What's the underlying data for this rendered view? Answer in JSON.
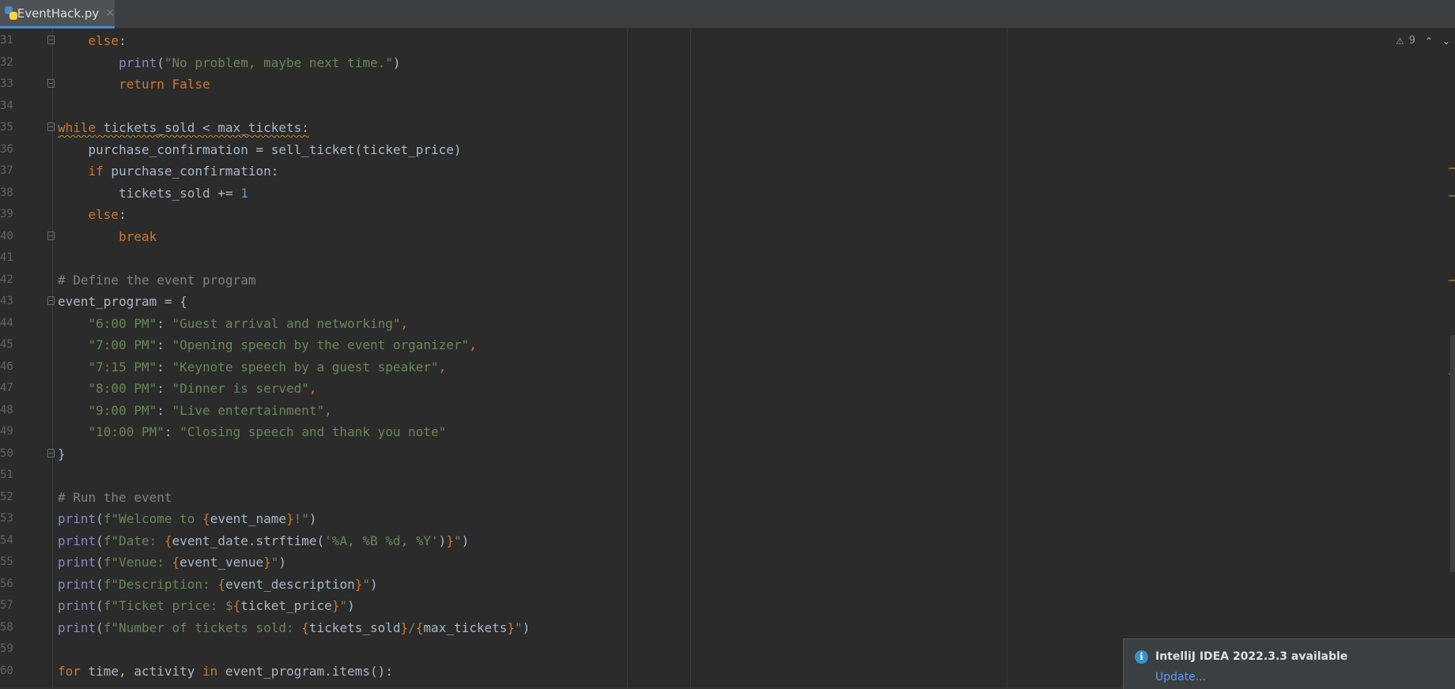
{
  "tab": {
    "filename": "EventHack.py",
    "close": "✕",
    "icon": "python-file-icon"
  },
  "inspection": {
    "warning_count": "9",
    "warning_icon": "⚠",
    "up": "⌃",
    "down": "⌄"
  },
  "notification": {
    "title": "IntelliJ IDEA 2022.3.3 available",
    "link": "Update...",
    "icon": "i"
  },
  "colors": {
    "keyword": "#cc7832",
    "string": "#6a8759",
    "number": "#6897bb",
    "comment": "#808080",
    "builtin": "#8888c6",
    "text": "#a9b7c6",
    "accent": "#4a88c7"
  },
  "code_lines": [
    {
      "n": "31",
      "tokens": [
        [
          "",
          "    "
        ],
        [
          "kw",
          "else"
        ],
        [
          "",
          ":"
        ]
      ]
    },
    {
      "n": "32",
      "tokens": [
        [
          "",
          "        "
        ],
        [
          "fn",
          "print"
        ],
        [
          "",
          "("
        ],
        [
          "str",
          "\"No problem, maybe next time.\""
        ],
        [
          "",
          ")"
        ]
      ]
    },
    {
      "n": "33",
      "tokens": [
        [
          "",
          "        "
        ],
        [
          "kw",
          "return False"
        ]
      ]
    },
    {
      "n": "34",
      "tokens": []
    },
    {
      "n": "35",
      "tokens": [
        [
          "kwu",
          "while"
        ],
        [
          "u",
          " tickets_sold < max_tickets:"
        ]
      ]
    },
    {
      "n": "36",
      "tokens": [
        [
          "",
          "    purchase_confirmation = sell_ticket(ticket_price)"
        ]
      ]
    },
    {
      "n": "37",
      "tokens": [
        [
          "",
          "    "
        ],
        [
          "kw",
          "if"
        ],
        [
          "",
          " purchase_confirmation:"
        ]
      ]
    },
    {
      "n": "38",
      "tokens": [
        [
          "",
          "        tickets_sold += "
        ],
        [
          "num",
          "1"
        ]
      ]
    },
    {
      "n": "39",
      "tokens": [
        [
          "",
          "    "
        ],
        [
          "kw",
          "else"
        ],
        [
          "",
          ":"
        ]
      ]
    },
    {
      "n": "40",
      "tokens": [
        [
          "",
          "        "
        ],
        [
          "kw",
          "break"
        ]
      ]
    },
    {
      "n": "41",
      "tokens": []
    },
    {
      "n": "42",
      "tokens": [
        [
          "cm",
          "# Define the event program"
        ]
      ]
    },
    {
      "n": "43",
      "tokens": [
        [
          "",
          "event_program = {"
        ]
      ]
    },
    {
      "n": "44",
      "tokens": [
        [
          "",
          "    "
        ],
        [
          "str",
          "\"6:00 PM\""
        ],
        [
          "",
          ": "
        ],
        [
          "str",
          "\"Guest arrival and networking\""
        ],
        [
          "kw",
          ","
        ]
      ]
    },
    {
      "n": "45",
      "tokens": [
        [
          "",
          "    "
        ],
        [
          "str",
          "\"7:00 PM\""
        ],
        [
          "",
          ": "
        ],
        [
          "str",
          "\"Opening speech by the event organizer\""
        ],
        [
          "kw",
          ","
        ]
      ]
    },
    {
      "n": "46",
      "tokens": [
        [
          "",
          "    "
        ],
        [
          "str",
          "\"7:15 PM\""
        ],
        [
          "",
          ": "
        ],
        [
          "str",
          "\"Keynote speech by a guest speaker\""
        ],
        [
          "kw",
          ","
        ]
      ]
    },
    {
      "n": "47",
      "tokens": [
        [
          "",
          "    "
        ],
        [
          "str",
          "\"8:00 PM\""
        ],
        [
          "",
          ": "
        ],
        [
          "str",
          "\"Dinner is served\""
        ],
        [
          "kw",
          ","
        ]
      ]
    },
    {
      "n": "48",
      "tokens": [
        [
          "",
          "    "
        ],
        [
          "str",
          "\"9:00 PM\""
        ],
        [
          "",
          ": "
        ],
        [
          "str",
          "\"Live entertainment\""
        ],
        [
          "kw",
          ","
        ]
      ]
    },
    {
      "n": "49",
      "tokens": [
        [
          "",
          "    "
        ],
        [
          "str",
          "\"10:00 PM\""
        ],
        [
          "",
          ": "
        ],
        [
          "str",
          "\"Closing speech and thank you note\""
        ]
      ]
    },
    {
      "n": "50",
      "tokens": [
        [
          "",
          "}"
        ]
      ]
    },
    {
      "n": "51",
      "tokens": []
    },
    {
      "n": "52",
      "tokens": [
        [
          "cm",
          "# Run the event"
        ]
      ]
    },
    {
      "n": "53",
      "tokens": [
        [
          "fn",
          "print"
        ],
        [
          "",
          "("
        ],
        [
          "str",
          "f\"Welcome to "
        ],
        [
          "kw",
          "{"
        ],
        [
          "",
          "event_name"
        ],
        [
          "kw",
          "}"
        ],
        [
          "str",
          "!\""
        ],
        [
          "",
          ")"
        ]
      ]
    },
    {
      "n": "54",
      "tokens": [
        [
          "fn",
          "print"
        ],
        [
          "",
          "("
        ],
        [
          "str",
          "f\"Date: "
        ],
        [
          "kw",
          "{"
        ],
        [
          "",
          "event_date.strftime("
        ],
        [
          "str",
          "'%A, %B %d, %Y'"
        ],
        [
          "",
          ")"
        ],
        [
          "kw",
          "}"
        ],
        [
          "str",
          "\""
        ],
        [
          "",
          ")"
        ]
      ]
    },
    {
      "n": "55",
      "tokens": [
        [
          "fn",
          "print"
        ],
        [
          "",
          "("
        ],
        [
          "str",
          "f\"Venue: "
        ],
        [
          "kw",
          "{"
        ],
        [
          "",
          "event_venue"
        ],
        [
          "kw",
          "}"
        ],
        [
          "str",
          "\""
        ],
        [
          "",
          ")"
        ]
      ]
    },
    {
      "n": "56",
      "tokens": [
        [
          "fn",
          "print"
        ],
        [
          "",
          "("
        ],
        [
          "str",
          "f\"Description: "
        ],
        [
          "kw",
          "{"
        ],
        [
          "",
          "event_description"
        ],
        [
          "kw",
          "}"
        ],
        [
          "str",
          "\""
        ],
        [
          "",
          ")"
        ]
      ]
    },
    {
      "n": "57",
      "tokens": [
        [
          "fn",
          "print"
        ],
        [
          "",
          "("
        ],
        [
          "str",
          "f\"Ticket price: $"
        ],
        [
          "kw",
          "{"
        ],
        [
          "",
          "ticket_price"
        ],
        [
          "kw",
          "}"
        ],
        [
          "str",
          "\""
        ],
        [
          "",
          ")"
        ]
      ]
    },
    {
      "n": "58",
      "tokens": [
        [
          "fn",
          "print"
        ],
        [
          "",
          "("
        ],
        [
          "str",
          "f\"Number of tickets sold: "
        ],
        [
          "kw",
          "{"
        ],
        [
          "",
          "tickets_sold"
        ],
        [
          "kw",
          "}"
        ],
        [
          "str",
          "/"
        ],
        [
          "kw",
          "{"
        ],
        [
          "",
          "max_tickets"
        ],
        [
          "kw",
          "}"
        ],
        [
          "str",
          "\""
        ],
        [
          "",
          ")"
        ]
      ]
    },
    {
      "n": "59",
      "tokens": []
    },
    {
      "n": "60",
      "tokens": [
        [
          "kw",
          "for"
        ],
        [
          "",
          " time, activity "
        ],
        [
          "kw",
          "in"
        ],
        [
          "",
          " event_program.items():"
        ]
      ]
    }
  ]
}
